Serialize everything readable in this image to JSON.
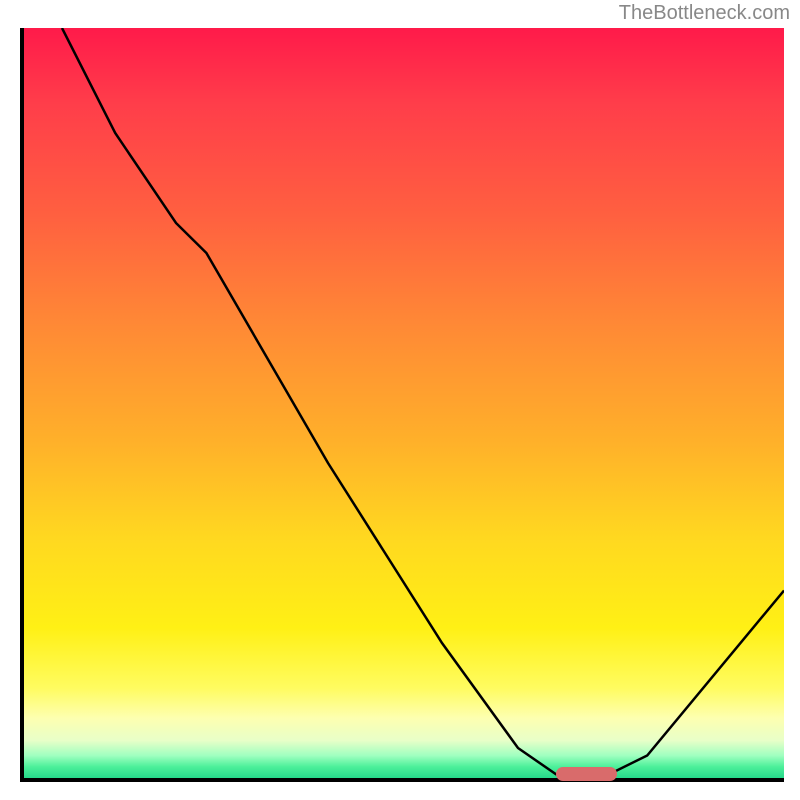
{
  "watermark": "TheBottleneck.com",
  "chart_data": {
    "type": "line",
    "title": "",
    "xlabel": "",
    "ylabel": "",
    "x_range": [
      0,
      100
    ],
    "y_range": [
      0,
      100
    ],
    "curve": [
      {
        "x": 5.0,
        "y": 100.0
      },
      {
        "x": 12.0,
        "y": 86.0
      },
      {
        "x": 20.0,
        "y": 74.0
      },
      {
        "x": 24.0,
        "y": 70.0
      },
      {
        "x": 40.0,
        "y": 42.0
      },
      {
        "x": 55.0,
        "y": 18.0
      },
      {
        "x": 65.0,
        "y": 4.0
      },
      {
        "x": 70.0,
        "y": 0.5
      },
      {
        "x": 77.0,
        "y": 0.5
      },
      {
        "x": 82.0,
        "y": 3.0
      },
      {
        "x": 100.0,
        "y": 25.0
      }
    ],
    "optimal_marker": {
      "x_start": 70,
      "x_end": 78,
      "y": 0.5
    },
    "gradient_stops": [
      {
        "pos": 0,
        "color": "#ff1a4a"
      },
      {
        "pos": 50,
        "color": "#ff9030"
      },
      {
        "pos": 80,
        "color": "#fff015"
      },
      {
        "pos": 100,
        "color": "#26d98a"
      }
    ]
  }
}
